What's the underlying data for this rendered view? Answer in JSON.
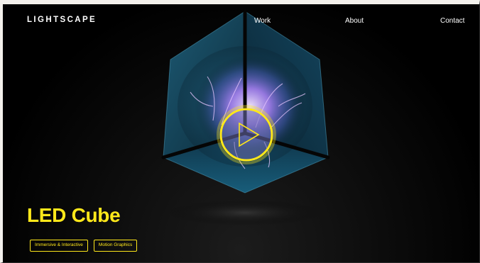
{
  "brand": {
    "logo": "LIGHTSCAPE"
  },
  "nav": {
    "work": "Work",
    "about": "About",
    "contact": "Contact"
  },
  "hero": {
    "title": "LED Cube",
    "tags": [
      "Immersive & Interactive",
      "Motion Graphics"
    ],
    "accent_color": "#ffe81a",
    "play_icon": "play-icon"
  }
}
